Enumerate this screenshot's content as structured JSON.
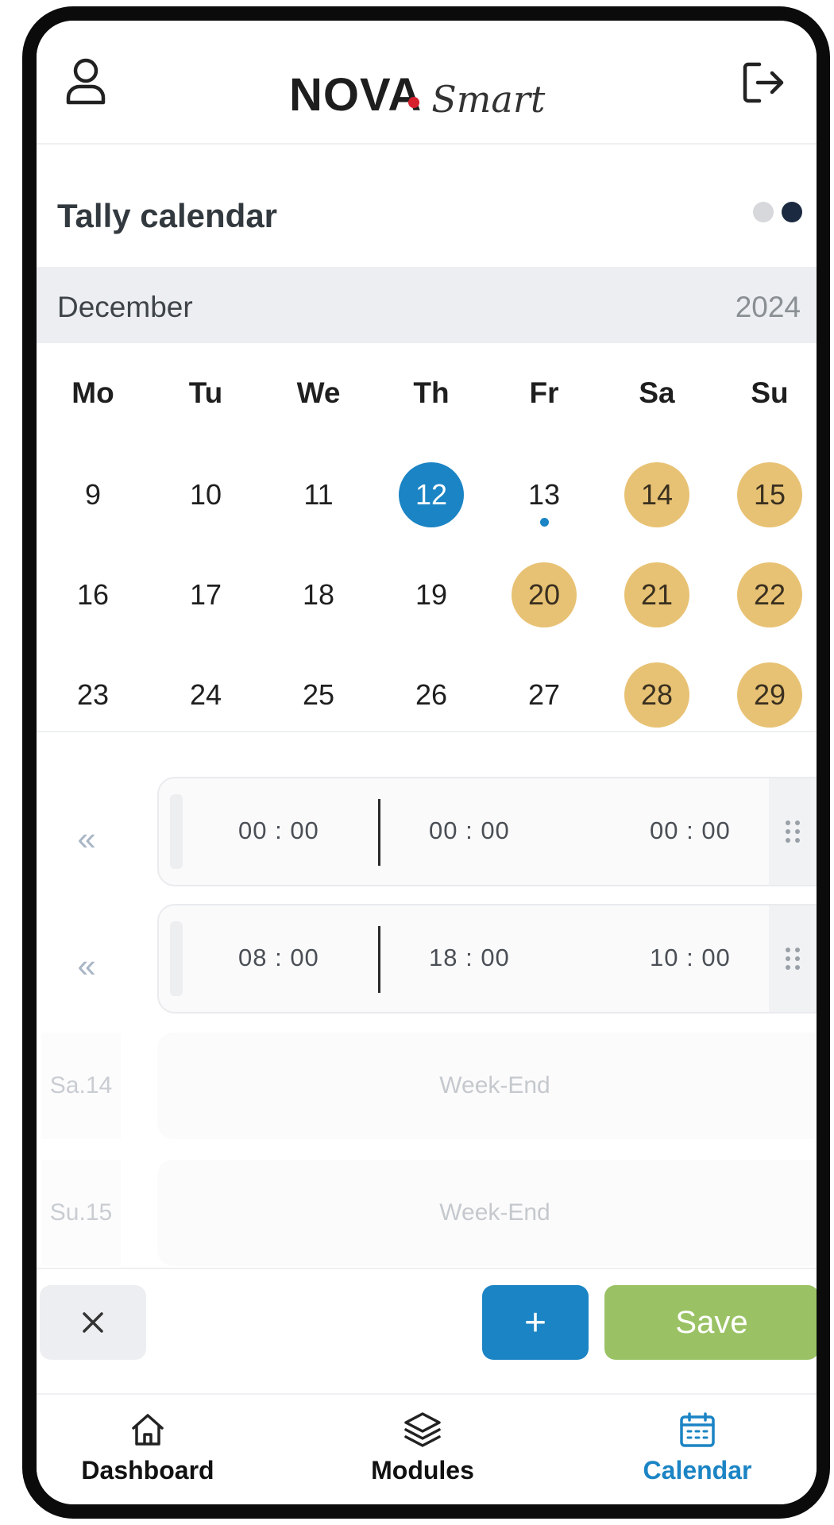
{
  "header": {
    "logo_primary": "NOVA",
    "logo_secondary": "Smart"
  },
  "page": {
    "title": "Tally calendar"
  },
  "calendar": {
    "month": "December",
    "year": "2024",
    "weekdays": [
      "Mo",
      "Tu",
      "We",
      "Th",
      "Fr",
      "Sa",
      "Su"
    ],
    "weeks": [
      [
        "9",
        "10",
        "11",
        "12",
        "13",
        "14",
        "15"
      ],
      [
        "16",
        "17",
        "18",
        "19",
        "20",
        "21",
        "22"
      ],
      [
        "23",
        "24",
        "25",
        "26",
        "27",
        "28",
        "29"
      ]
    ],
    "selected_day": "12",
    "event_day": "13",
    "highlighted_days": [
      "14",
      "15",
      "20",
      "21",
      "22",
      "28",
      "29"
    ],
    "colors": {
      "selected": "#1b84c4",
      "highlight": "#e8c274",
      "event_dot": "#1b84c4"
    }
  },
  "time_rows": [
    {
      "nav_label": "«",
      "start": "00 : 00",
      "end": "00 : 00",
      "total": "00 : 00"
    },
    {
      "nav_label": "«",
      "start": "08 : 00",
      "end": "18 : 00",
      "total": "10 : 00"
    }
  ],
  "weekend_rows": [
    {
      "day_label": "Sa.14",
      "status": "Week-End"
    },
    {
      "day_label": "Su.15",
      "status": "Week-End"
    }
  ],
  "actions": {
    "close_icon": "close-icon",
    "add_label": "+",
    "save_label": "Save",
    "colors": {
      "add": "#1b84c4",
      "save": "#9ac264",
      "close_bg": "#eceef1"
    }
  },
  "bottom_nav": [
    {
      "label": "Dashboard",
      "icon": "home-icon",
      "active": false
    },
    {
      "label": "Modules",
      "icon": "layers-icon",
      "active": false
    },
    {
      "label": "Calendar",
      "icon": "calendar-icon",
      "active": true
    }
  ],
  "theme": {
    "active_nav": "#1b84c4",
    "pager_inactive": "#d6d8dc",
    "pager_active": "#1b2a40"
  }
}
